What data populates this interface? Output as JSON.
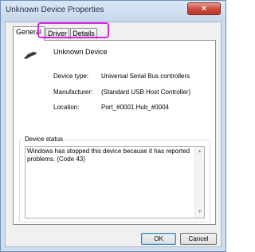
{
  "window": {
    "title": "Unknown Device Properties",
    "close_icon": "×"
  },
  "tabs": [
    {
      "label": "General",
      "active": true
    },
    {
      "label": "Driver",
      "active": false
    },
    {
      "label": "Details",
      "active": false
    }
  ],
  "device": {
    "name": "Unknown Device",
    "icon": "usb-device-icon"
  },
  "properties": [
    {
      "label": "Device type:",
      "value": "Universal Serial Bus controllers"
    },
    {
      "label": "Manufacturer:",
      "value": "(Standard USB Host Controller)"
    },
    {
      "label": "Location:",
      "value": "Port_#0001.Hub_#0004"
    }
  ],
  "status": {
    "legend": "Device status",
    "text": "Windows has stopped this device because it has reported problems. (Code 43)",
    "scroll_up": "▲",
    "scroll_down": "▼"
  },
  "buttons": {
    "ok": "OK",
    "cancel": "Cancel"
  },
  "colors": {
    "highlight": "#e024e0",
    "close_button": "#c8473a"
  }
}
